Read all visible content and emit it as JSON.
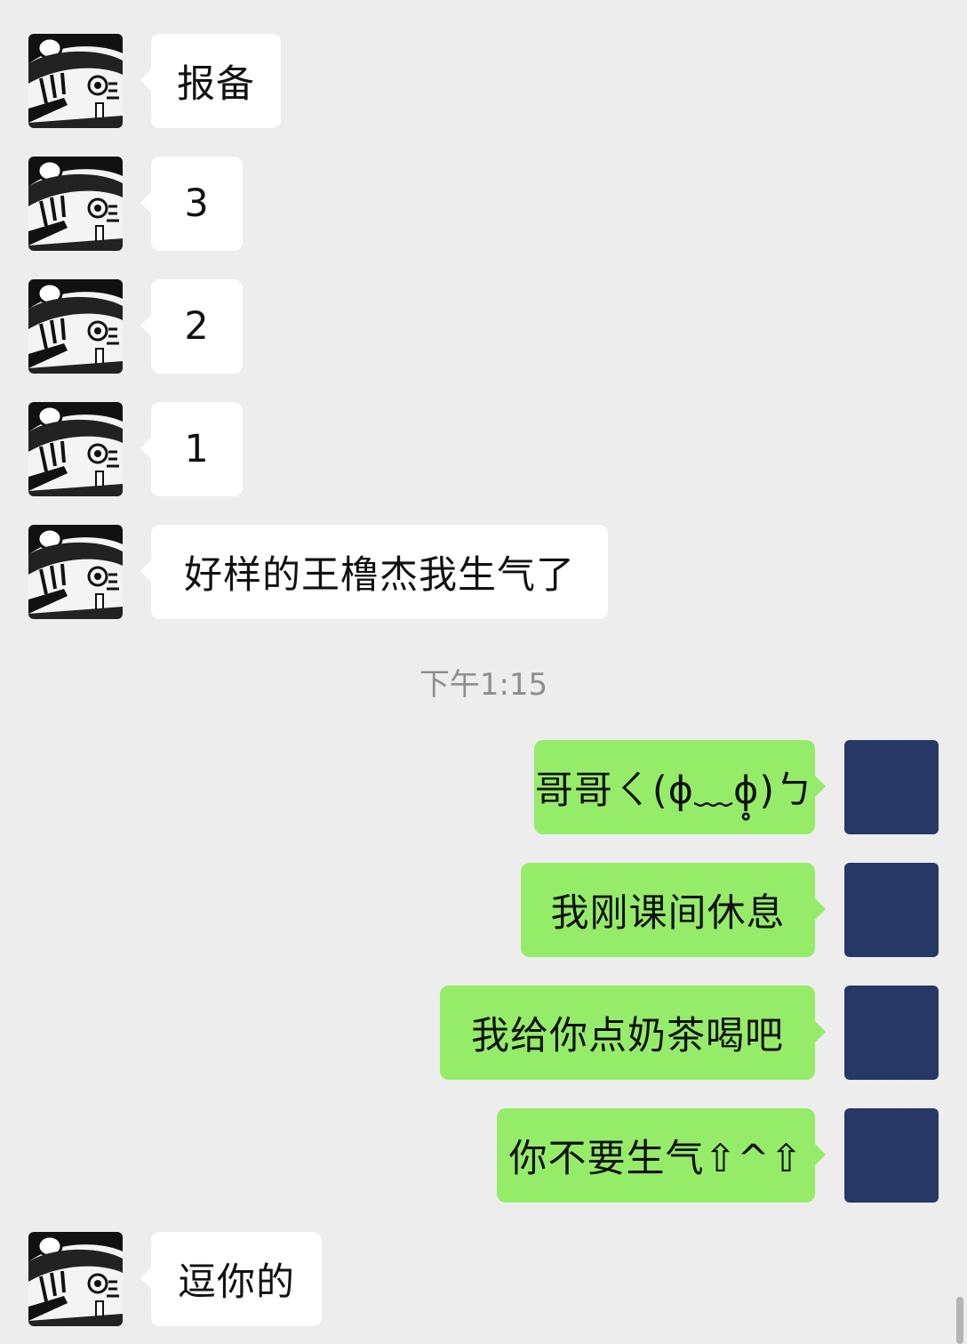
{
  "messages": [
    {
      "text": "报备"
    },
    {
      "text": "3"
    },
    {
      "text": "2"
    },
    {
      "text": "1"
    },
    {
      "text": "好样的王橹杰我生气了"
    },
    {
      "text": "哥哥ㄑ(ɸ﹏ɸ̥̥)ㄅ"
    },
    {
      "text": "我刚课间休息"
    },
    {
      "text": "我给你点奶茶喝吧"
    },
    {
      "text": "你不要生气⇧^⇧"
    },
    {
      "text": "逗你的"
    }
  ],
  "timestamp": "下午1:15",
  "colors": {
    "background": "#ededed",
    "incoming_bubble": "#ffffff",
    "outgoing_bubble": "#95ec69",
    "my_avatar": "#283866",
    "timestamp_text": "#8e8e8e"
  }
}
